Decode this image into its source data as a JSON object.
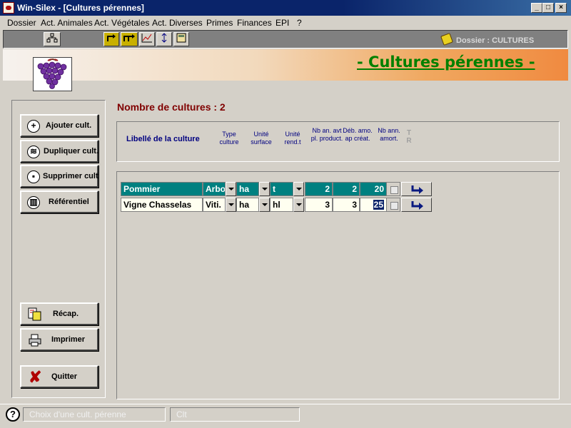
{
  "window": {
    "title": "Win-Silex - [Cultures pérennes]",
    "minimize": "_",
    "maximize": "□",
    "close": "×"
  },
  "menu": [
    "Dossier",
    "Act. Animales",
    "Act. Végétales",
    "Act. Diverses",
    "Primes",
    "Finances",
    "EPI",
    "?"
  ],
  "toolbar": {
    "dossier_label": "Dossier : CULTURES"
  },
  "header": {
    "title": "- Cultures pérennes -"
  },
  "sidebar": {
    "ajouter": "Ajouter cult.",
    "dupliquer": "Dupliquer cult.",
    "supprimer": "Supprimer cult",
    "referentiel": "Référentiel",
    "recap": "Récap.",
    "imprimer": "Imprimer",
    "quitter": "Quitter"
  },
  "count_label": "Nombre de cultures : 2",
  "columns": {
    "libelle": "Libellé de la culture",
    "type": "Type culture",
    "unite_surface": "Unité surface",
    "unite_rend": "Unité rend.t",
    "nb_an_avt": "Nb an. avt pl. product.",
    "deb_amo": "Déb. amo. ap créat.",
    "nb_ann_amort": "Nb ann. amort.",
    "tr": "T R"
  },
  "rows": [
    {
      "libelle": "Pommier",
      "type": "Arbo",
      "surface": "ha",
      "rend": "t",
      "nb_an_avt": "2",
      "deb_amo": "2",
      "nb_ann_amort": "20"
    },
    {
      "libelle": "Vigne Chasselas",
      "type": "Viti.",
      "surface": "ha",
      "rend": "hl",
      "nb_an_avt": "3",
      "deb_amo": "3",
      "nb_ann_amort": "25"
    }
  ],
  "status": {
    "field1": "Choix d'une cult. pérenne",
    "field2": "Clt"
  },
  "colors": {
    "title_green": "#008000",
    "count_red": "#800000",
    "grid_header": "#008080"
  }
}
